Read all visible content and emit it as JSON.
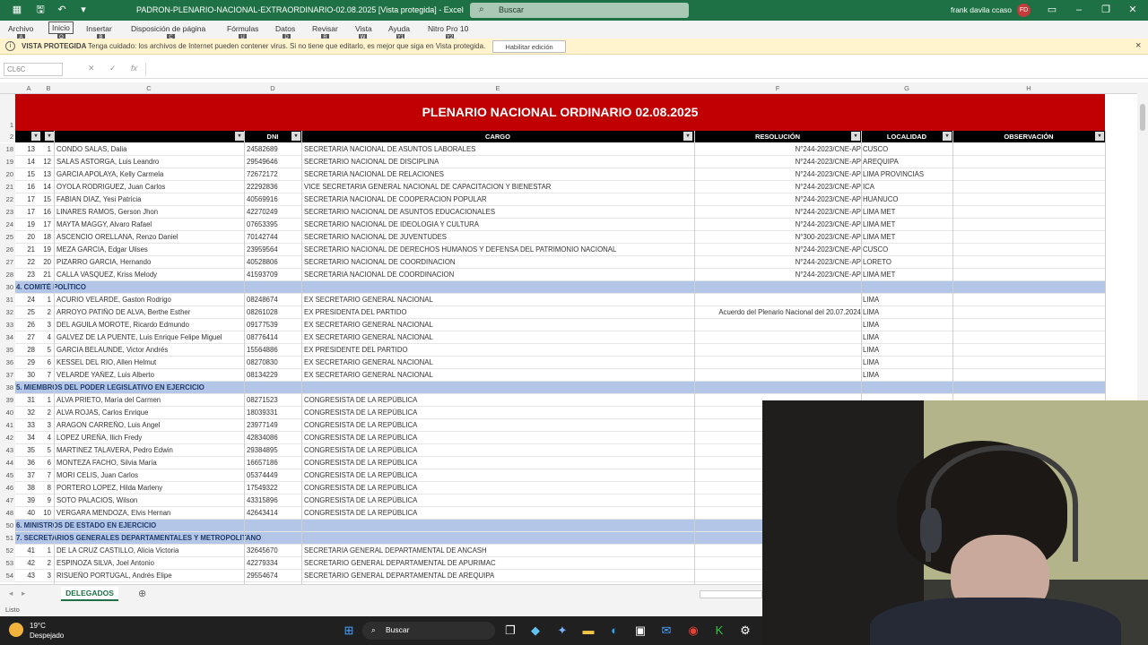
{
  "window": {
    "title": "PADRON-PLENARIO-NACIONAL-EXTRAORDINARIO-02.08.2025 [Vista protegida] - Excel",
    "search_placeholder": "Buscar",
    "user_name": "frank davila ccaso",
    "user_initials": "FD"
  },
  "menu": {
    "items": [
      "Archivo",
      "Inicio",
      "Insertar",
      "Disposición de página",
      "Fórmulas",
      "Datos",
      "Revisar",
      "Vista",
      "Ayuda",
      "Nitro Pro 10"
    ],
    "keys": [
      "A",
      "O",
      "B",
      "C",
      "U",
      "D",
      "R",
      "W",
      "Y1",
      "Y2"
    ]
  },
  "infobar": {
    "label": "VISTA PROTEGIDA",
    "message": "Tenga cuidado: los archivos de Internet pueden contener virus. Si no tiene que editarlo, es mejor que siga en Vista protegida.",
    "button": "Habilitar edición"
  },
  "formula_bar": {
    "name_box": "CL6C",
    "content": ""
  },
  "columns": [
    "A",
    "B",
    "C",
    "D",
    "E",
    "F",
    "G",
    "H"
  ],
  "sheet": {
    "banner": "PLENARIO NACIONAL ORDINARIO 02.08.2025",
    "headers": {
      "dni": "DNI",
      "cargo": "CARGO",
      "resolucion": "RESOLUCIÓN",
      "localidad": "LOCALIDAD",
      "observacion": "OBSERVACIÓN"
    },
    "rows": [
      {
        "r": "18",
        "a": "13",
        "b": "1",
        "name": "CONDO SALAS, Dalia",
        "dni": "24582689",
        "cargo": "SECRETARIA NACIONAL DE ASUNTOS LABORALES",
        "res": "N°244-2023/CNE-AP",
        "loc": "CUSCO",
        "section": false
      },
      {
        "r": "19",
        "a": "14",
        "b": "12",
        "name": "SALAS ASTORGA, Luis Leandro",
        "dni": "29549646",
        "cargo": "SECRETARIO NACIONAL DE DISCIPLINA",
        "res": "N°244-2023/CNE-AP",
        "loc": "AREQUIPA",
        "section": false
      },
      {
        "r": "20",
        "a": "15",
        "b": "13",
        "name": "GARCIA APOLAYA, Kelly Carmela",
        "dni": "72672172",
        "cargo": "SECRETARIA NACIONAL DE RELACIONES",
        "res": "N°244-2023/CNE-AP",
        "loc": "LIMA PROVINCIAS",
        "section": false
      },
      {
        "r": "21",
        "a": "16",
        "b": "14",
        "name": "OYOLA RODRIGUEZ, Juan Carlos",
        "dni": "22292836",
        "cargo": "VICE SECRETARIA GENERAL NACIONAL DE CAPACITACION Y BIENESTAR",
        "res": "N°244-2023/CNE-AP",
        "loc": "ICA",
        "section": false
      },
      {
        "r": "22",
        "a": "17",
        "b": "15",
        "name": "FABIAN DIAZ, Yesi Patricia",
        "dni": "40569916",
        "cargo": "SECRETARIA NACIONAL DE COOPERACION POPULAR",
        "res": "N°244-2023/CNE-AP",
        "loc": "HUANUCO",
        "section": false
      },
      {
        "r": "23",
        "a": "17",
        "b": "16",
        "name": "LINARES RAMOS, Gerson Jhon",
        "dni": "42270249",
        "cargo": "SECRETARIO NACIONAL DE ASUNTOS EDUCACIONALES",
        "res": "N°244-2023/CNE-AP",
        "loc": "LIMA MET",
        "section": false
      },
      {
        "r": "24",
        "a": "19",
        "b": "17",
        "name": "MAYTA MAGGY, Alvaro Rafael",
        "dni": "07653395",
        "cargo": "SECRETARIO NACIONAL DE IDEOLOGIA Y CULTURA",
        "res": "N°244-2023/CNE-AP",
        "loc": "LIMA MET",
        "section": false
      },
      {
        "r": "25",
        "a": "20",
        "b": "18",
        "name": "ASCENCIO ORELLANA, Renzo Daniel",
        "dni": "70142744",
        "cargo": "SECRETARIO NACIONAL DE JUVENTUDES",
        "res": "N°300-2023/CNE-AP",
        "loc": "LIMA MET",
        "section": false
      },
      {
        "r": "26",
        "a": "21",
        "b": "19",
        "name": "MEZA GARCIA, Edgar Ulises",
        "dni": "23959564",
        "cargo": "SECRETARIO NACIONAL DE DERECHOS HUMANOS Y DEFENSA DEL PATRIMONIO NACIONAL",
        "res": "N°244-2023/CNE-AP",
        "loc": "CUSCO",
        "section": false
      },
      {
        "r": "27",
        "a": "22",
        "b": "20",
        "name": "PIZARRO GARCIA, Hernando",
        "dni": "40528806",
        "cargo": "SECRETARIO NACIONAL DE COORDINACION",
        "res": "N°244-2023/CNE-AP",
        "loc": "LORETO",
        "section": false
      },
      {
        "r": "28",
        "a": "23",
        "b": "21",
        "name": "CALLA VASQUEZ, Kriss Melody",
        "dni": "41593709",
        "cargo": "SECRETARIA NACIONAL DE COORDINACION",
        "res": "N°244-2023/CNE-AP",
        "loc": "LIMA MET",
        "section": false
      },
      {
        "r": "30",
        "a": "",
        "b": "",
        "name": "4. COMITÉ POLÍTICO",
        "dni": "",
        "cargo": "",
        "res": "",
        "loc": "",
        "section": true
      },
      {
        "r": "31",
        "a": "24",
        "b": "1",
        "name": "ACURIO VELARDE, Gaston Rodrigo",
        "dni": "08248674",
        "cargo": "EX SECRETARIO GENERAL NACIONAL",
        "res": "",
        "loc": "LIMA",
        "section": false
      },
      {
        "r": "32",
        "a": "25",
        "b": "2",
        "name": "ARROYO PATIÑO DE ALVA, Berthe Esther",
        "dni": "08261028",
        "cargo": "EX PRESIDENTA DEL PARTIDO",
        "res": "Acuerdo del Plenario Nacional del 20.07.2024",
        "loc": "LIMA",
        "section": false
      },
      {
        "r": "33",
        "a": "26",
        "b": "3",
        "name": "DEL AGUILA MOROTE, Ricardo Edmundo",
        "dni": "09177539",
        "cargo": "EX SECRETARIO GENERAL NACIONAL",
        "res": "",
        "loc": "LIMA",
        "section": false
      },
      {
        "r": "34",
        "a": "27",
        "b": "4",
        "name": "GALVEZ DE LA PUENTE, Luis Enrique Felipe Miguel",
        "dni": "08776414",
        "cargo": "EX SECRETARIO GENERAL NACIONAL",
        "res": "",
        "loc": "LIMA",
        "section": false
      },
      {
        "r": "35",
        "a": "28",
        "b": "5",
        "name": "GARCIA BELAUNDE, Victor Andrés",
        "dni": "15564886",
        "cargo": "EX PRESIDENTE DEL PARTIDO",
        "res": "",
        "loc": "LIMA",
        "section": false
      },
      {
        "r": "36",
        "a": "29",
        "b": "6",
        "name": "KESSEL DEL RIO, Allen Helmut",
        "dni": "08270830",
        "cargo": "EX SECRETARIO GENERAL NACIONAL",
        "res": "",
        "loc": "LIMA",
        "section": false
      },
      {
        "r": "37",
        "a": "30",
        "b": "7",
        "name": "VELARDE YAÑEZ, Luis Alberto",
        "dni": "08134229",
        "cargo": "EX SECRETARIO GENERAL NACIONAL",
        "res": "",
        "loc": "LIMA",
        "section": false
      },
      {
        "r": "38",
        "a": "",
        "b": "",
        "name": "5. MIEMBROS DEL PODER LEGISLATIVO EN EJERCICIO",
        "dni": "",
        "cargo": "",
        "res": "",
        "loc": "",
        "section": true
      },
      {
        "r": "39",
        "a": "31",
        "b": "1",
        "name": "ALVA PRIETO, María del Carmen",
        "dni": "08271523",
        "cargo": "CONGRESISTA DE LA REPÚBLICA",
        "res": "",
        "loc": "",
        "section": false
      },
      {
        "r": "40",
        "a": "32",
        "b": "2",
        "name": "ALVA ROJAS, Carlos Enrique",
        "dni": "18039331",
        "cargo": "CONGRESISTA DE LA REPÚBLICA",
        "res": "",
        "loc": "",
        "section": false
      },
      {
        "r": "41",
        "a": "33",
        "b": "3",
        "name": "ARAGON CARREÑO, Luis Angel",
        "dni": "23977149",
        "cargo": "CONGRESISTA DE LA REPÚBLICA",
        "res": "",
        "loc": "",
        "section": false
      },
      {
        "r": "42",
        "a": "34",
        "b": "4",
        "name": "LOPEZ UREÑA, Ilich Fredy",
        "dni": "42834086",
        "cargo": "CONGRESISTA DE LA REPÚBLICA",
        "res": "",
        "loc": "",
        "section": false
      },
      {
        "r": "43",
        "a": "35",
        "b": "5",
        "name": "MARTINEZ TALAVERA, Pedro Edwin",
        "dni": "29384895",
        "cargo": "CONGRESISTA DE LA REPÚBLICA",
        "res": "",
        "loc": "",
        "section": false
      },
      {
        "r": "44",
        "a": "36",
        "b": "6",
        "name": "MONTEZA FACHO, Silvia María",
        "dni": "16657186",
        "cargo": "CONGRESISTA DE LA REPÚBLICA",
        "res": "",
        "loc": "",
        "section": false
      },
      {
        "r": "45",
        "a": "37",
        "b": "7",
        "name": "MORI CELIS, Juan Carlos",
        "dni": "05374449",
        "cargo": "CONGRESISTA DE LA REPÚBLICA",
        "res": "",
        "loc": "",
        "section": false
      },
      {
        "r": "46",
        "a": "38",
        "b": "8",
        "name": "PORTERO LOPEZ, Hilda Marleny",
        "dni": "17549322",
        "cargo": "CONGRESISTA DE LA REPÚBLICA",
        "res": "",
        "loc": "",
        "section": false
      },
      {
        "r": "47",
        "a": "39",
        "b": "9",
        "name": "SOTO PALACIOS, Wilson",
        "dni": "43315896",
        "cargo": "CONGRESISTA DE LA REPÚBLICA",
        "res": "",
        "loc": "",
        "section": false
      },
      {
        "r": "48",
        "a": "40",
        "b": "10",
        "name": "VERGARA MENDOZA, Elvis Hernan",
        "dni": "42643414",
        "cargo": "CONGRESISTA DE LA REPÚBLICA",
        "res": "",
        "loc": "",
        "section": false
      },
      {
        "r": "50",
        "a": "",
        "b": "",
        "name": "6. MINISTROS DE ESTADO EN EJERCICIO",
        "dni": "",
        "cargo": "",
        "res": "",
        "loc": "",
        "section": true
      },
      {
        "r": "51",
        "a": "",
        "b": "",
        "name": "7. SECRETARIOS GENERALES DEPARTAMENTALES Y METROPOLITANO",
        "dni": "",
        "cargo": "",
        "res": "",
        "loc": "",
        "section": true
      },
      {
        "r": "52",
        "a": "41",
        "b": "1",
        "name": "DE LA CRUZ CASTILLO, Alicia Victoria",
        "dni": "32645670",
        "cargo": "SECRETARIA GENERAL DEPARTAMENTAL DE ANCASH",
        "res": "N°214",
        "loc": "",
        "section": false
      },
      {
        "r": "53",
        "a": "42",
        "b": "2",
        "name": "ESPINOZA SILVA, Joel Antonio",
        "dni": "42279334",
        "cargo": "SECRETARIO GENERAL DEPARTAMENTAL DE APURIMAC",
        "res": "N° 024",
        "loc": "",
        "section": false
      },
      {
        "r": "54",
        "a": "43",
        "b": "3",
        "name": "RISUEÑO PORTUGAL, Andrés Elipe",
        "dni": "29554674",
        "cargo": "SECRETARIO GENERAL DEPARTAMENTAL DE AREQUIPA",
        "res": "N°021",
        "loc": "",
        "section": false
      }
    ]
  },
  "sheet_tab": "DELEGADOS",
  "status": "Listo",
  "taskbar": {
    "temp": "19°C",
    "weather": "Despejado",
    "search": "Buscar"
  },
  "colors": {
    "excel_green": "#1e7145",
    "banner_red": "#c00000",
    "section_blue": "#b4c6e7"
  }
}
